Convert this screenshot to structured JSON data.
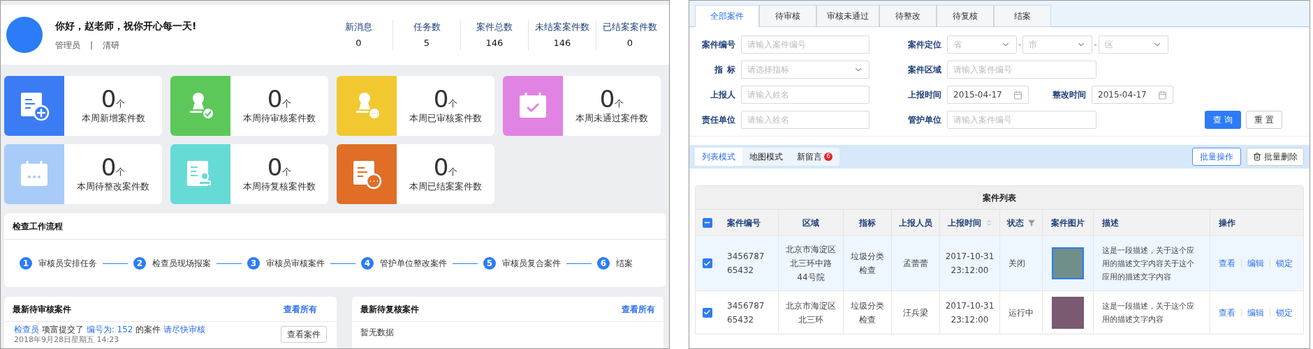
{
  "profile": {
    "greeting": "你好，赵老师，祝你开心每一天!",
    "role": "管理员",
    "separator": "|",
    "org": "清研"
  },
  "stats": [
    {
      "label": "新消息",
      "value": "0"
    },
    {
      "label": "任务数",
      "value": "5"
    },
    {
      "label": "案件总数",
      "value": "146"
    },
    {
      "label": "未结案案件数",
      "value": "146"
    },
    {
      "label": "已结案案件数",
      "value": "0"
    }
  ],
  "summary_cards": [
    {
      "kind": "doc-plus",
      "color": "#3b7cf5",
      "count": "0",
      "unit": "个",
      "label": "本周新增案件数"
    },
    {
      "kind": "stamp-check",
      "color": "#5cc85a",
      "count": "0",
      "unit": "个",
      "label": "本周待审核案件数"
    },
    {
      "kind": "stamp-dots",
      "color": "#f2c830",
      "count": "0",
      "unit": "个",
      "label": "本周已审核案件数"
    },
    {
      "kind": "calendar-check",
      "color": "#e183e3",
      "count": "0",
      "unit": "个",
      "label": "本周未通过案件数"
    },
    {
      "kind": "calendar-dots",
      "color": "#a9cbf8",
      "count": "0",
      "unit": "个",
      "label": "本周待整改案件数"
    },
    {
      "kind": "doc-person",
      "color": "#66dbd6",
      "count": "0",
      "unit": "个",
      "label": "本周待复核案件数"
    },
    {
      "kind": "doc-dots",
      "color": "#e06e26",
      "count": "0",
      "unit": "个",
      "label": "本周已结案案件数"
    }
  ],
  "workflow": {
    "title": "检查工作流程",
    "steps": [
      {
        "number": "1",
        "label": "审核员安排任务"
      },
      {
        "number": "2",
        "label": "检查员现场报案"
      },
      {
        "number": "3",
        "label": "审核员审核案件"
      },
      {
        "number": "4",
        "label": "管护单位整改案件"
      },
      {
        "number": "5",
        "label": "审核员复合案件"
      },
      {
        "number": "6",
        "label": "结案"
      }
    ]
  },
  "pending_review": {
    "title": "最新待审核案件",
    "view_all": "查看所有",
    "items": [
      {
        "segments": [
          {
            "kind": "link",
            "text": "检查员"
          },
          {
            "kind": "text",
            "text": " 项富提交了 "
          },
          {
            "kind": "link",
            "text": "编号为: 152"
          },
          {
            "kind": "text",
            "text": " 的案件 "
          },
          {
            "kind": "link",
            "text": "请尽快审核"
          }
        ],
        "date": "2018年9月28日星期五 14:23",
        "button": "查看案件"
      }
    ]
  },
  "pending_recheck": {
    "title": "最新待复核案件",
    "view_all": "查看所有",
    "empty": "暂无数据"
  },
  "tabs": [
    {
      "label": "全部案件",
      "selected": true
    },
    {
      "label": "待审核",
      "selected": false
    },
    {
      "label": "审核未通过",
      "selected": false
    },
    {
      "label": "待整改",
      "selected": false
    },
    {
      "label": "待复核",
      "selected": false
    },
    {
      "label": "结案",
      "selected": false
    }
  ],
  "filters": {
    "case_no": {
      "label": "案件编号",
      "placeholder": "请输入案件编号"
    },
    "location": {
      "label": "案件定位",
      "selects": [
        {
          "placeholder": "省"
        },
        {
          "placeholder": "市"
        },
        {
          "placeholder": "区"
        }
      ],
      "dash": "-"
    },
    "indicator": {
      "label_chars": [
        "指",
        "标"
      ],
      "placeholder": "请选择指标"
    },
    "area": {
      "label": "案件区域",
      "placeholder": "请输入案件编号"
    },
    "reporter": {
      "label": "上报人",
      "placeholder": "请输入姓名"
    },
    "report_time": {
      "label": "上报时间",
      "value": "2015-04-17"
    },
    "fix_time": {
      "label": "整改时间",
      "value": "2015-04-17"
    },
    "unit": {
      "label": "责任单位",
      "placeholder": "请输入姓名"
    },
    "keeper": {
      "label": "管护单位",
      "placeholder": "请输入案件编号"
    },
    "search_button": "查 询",
    "reset_button": "重 置"
  },
  "view_modes": [
    {
      "label": "列表模式",
      "selected": true
    },
    {
      "label": "地图模式",
      "selected": false
    },
    {
      "label": "新留言",
      "selected": false,
      "badge": "6"
    }
  ],
  "batch_button": "批量操作",
  "batch_delete_button": "批量删除",
  "table": {
    "title": "案件列表",
    "header_indeterminate": true,
    "columns": [
      "案件编号",
      "区域",
      "指标",
      "上报人员",
      "上报时间",
      "状态",
      "案件图片",
      "描述",
      "操作"
    ],
    "rows": [
      {
        "checked": true,
        "selected": true,
        "case_no": [
          "3456787",
          "65432"
        ],
        "area": [
          "北京市海淀区",
          "北三环中路",
          "44号院"
        ],
        "indicator": [
          "垃圾分类",
          "检查"
        ],
        "reporter": "孟蕾蕾",
        "time": [
          "2017-10-31",
          "23:12:00"
        ],
        "status": "关闭",
        "desc": "这是一段描述，关于这个应用的描述文字内容关于这个应用的描述文字内容",
        "actions": [
          "查看",
          "编辑",
          "锁定"
        ]
      },
      {
        "checked": true,
        "selected": false,
        "case_no": [
          "3456787",
          "65432"
        ],
        "area": [
          "北京市海淀区",
          "北三环"
        ],
        "indicator": [
          "垃圾分类",
          "检查"
        ],
        "reporter": "汪兵梁",
        "time": [
          "2017-10-31",
          "23:12:00"
        ],
        "status": "运行中",
        "desc": "这是一段描述，关于这个应用的描述文字内容",
        "actions": [
          "查看",
          "编辑",
          "锁定"
        ]
      }
    ]
  }
}
